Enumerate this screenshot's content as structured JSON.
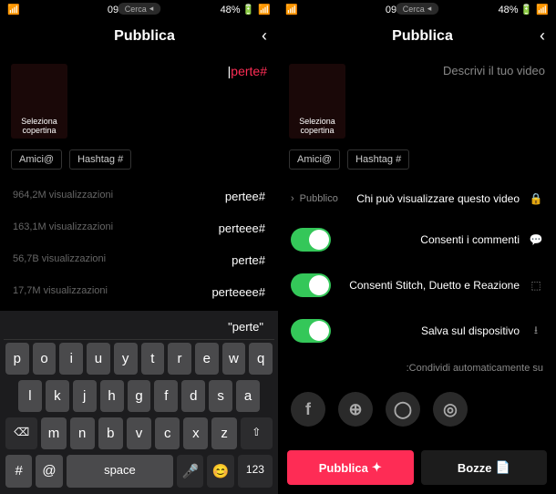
{
  "status": {
    "battery": "48%",
    "time": "09:39",
    "cerca": "Cerca"
  },
  "header": {
    "title": "Pubblica"
  },
  "thumb": {
    "label": "Seleziona copertina"
  },
  "left": {
    "description": "Descrivi il tuo video",
    "chips": {
      "hashtag": "# Hashtag",
      "friends": "@Amici"
    },
    "privacy": {
      "label": "Chi può visualizzare questo video",
      "value": "Pubblico"
    },
    "comments": "Consenti i commenti",
    "stitch": "Consenti Stitch, Duetto e Reazione",
    "save": "Salva sul dispositivo",
    "share": "Condividi automaticamente su:",
    "btn_draft": "Bozze",
    "btn_publish": "Pubblica"
  },
  "right": {
    "hashtag_input": "#perte",
    "chips": {
      "hashtag": "# Hashtag",
      "friends": "@Amici"
    },
    "suggestions": [
      {
        "tag": "#pertee",
        "count": "964,2M visualizzazioni"
      },
      {
        "tag": "#perteee",
        "count": "163,1M visualizzazioni"
      },
      {
        "tag": "#perte",
        "count": "56,7B visualizzazioni"
      },
      {
        "tag": "#perteeee",
        "count": "17,7M visualizzazioni"
      }
    ],
    "kb_suggestion": "\"perte\"",
    "keys": {
      "r1": [
        "q",
        "w",
        "e",
        "r",
        "t",
        "y",
        "u",
        "i",
        "o",
        "p"
      ],
      "r2": [
        "a",
        "s",
        "d",
        "f",
        "g",
        "h",
        "j",
        "k",
        "l"
      ],
      "r3": [
        "z",
        "x",
        "c",
        "v",
        "b",
        "n",
        "m"
      ],
      "shift": "⇧",
      "back": "⌫",
      "num": "123",
      "emoji": "😊",
      "mic": "🎤",
      "space": "space",
      "at": "@",
      "hash": "#"
    }
  }
}
